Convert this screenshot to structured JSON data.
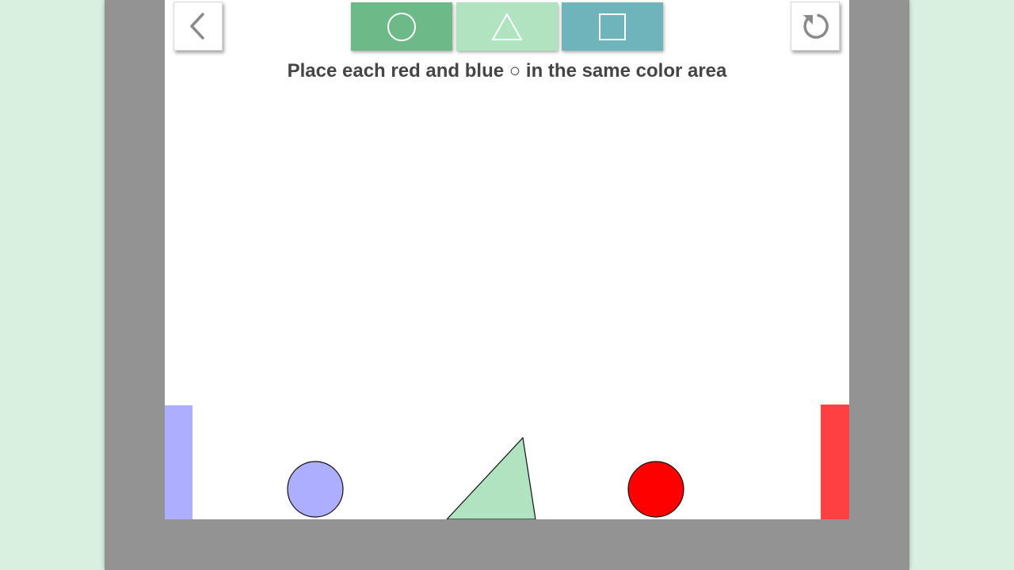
{
  "instruction": {
    "prefix": "Place each red and blue",
    "symbol": "○",
    "suffix": "in the same color area"
  },
  "toolbar": {
    "buttons": [
      {
        "shape": "circle-icon",
        "color": "#6dba88"
      },
      {
        "shape": "triangle-icon",
        "color": "#b0e3c0"
      },
      {
        "shape": "square-icon",
        "color": "#6fb4bb"
      }
    ]
  },
  "navigation": {
    "back_icon": "chevron-left-icon",
    "reset_icon": "reset-icon"
  },
  "colors": {
    "background": "#d9efe0",
    "frame": "#939393",
    "stage": "#ffffff",
    "blue_zone": "#aeaeff",
    "red_zone": "#ff4040",
    "blue_ball": "#aeaeff",
    "red_ball": "#ff0000",
    "triangle": "#b0e3c0",
    "icon_gray": "#8a8a8a",
    "text": "#454545"
  },
  "scene": {
    "zones": [
      {
        "name": "blue-goal-zone",
        "color": "blue"
      },
      {
        "name": "red-goal-zone",
        "color": "red"
      }
    ],
    "pieces": [
      {
        "name": "blue-ball",
        "shape": "circle",
        "color": "blue"
      },
      {
        "name": "green-triangle",
        "shape": "triangle",
        "color": "green"
      },
      {
        "name": "red-ball",
        "shape": "circle",
        "color": "red"
      }
    ]
  }
}
